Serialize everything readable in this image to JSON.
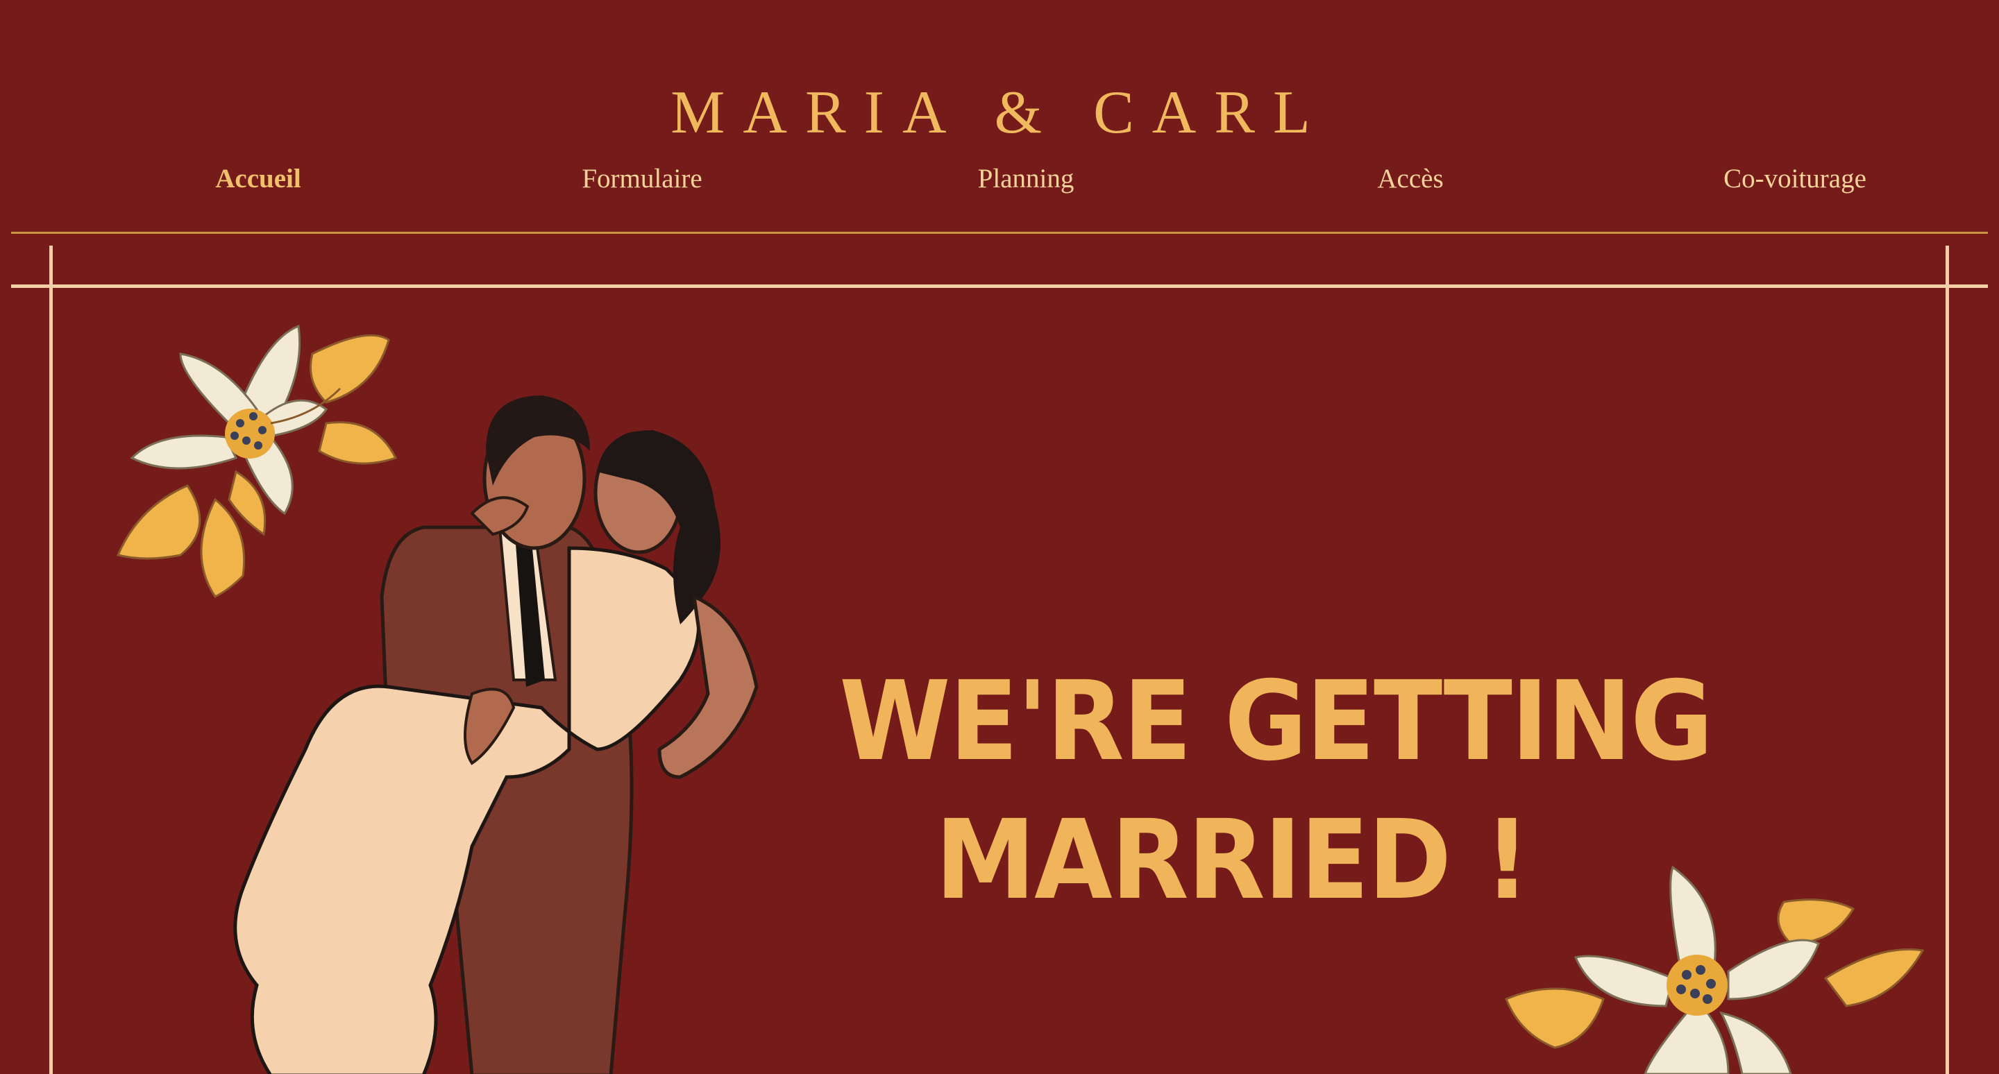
{
  "header": {
    "title": "MARIA & CARL"
  },
  "nav": {
    "items": [
      {
        "label": "Accueil",
        "active": true
      },
      {
        "label": "Formulaire",
        "active": false
      },
      {
        "label": "Planning",
        "active": false
      },
      {
        "label": "Accès",
        "active": false
      },
      {
        "label": "Co-voiturage",
        "active": false
      }
    ]
  },
  "hero": {
    "line1": "WE'RE GETTING",
    "line2": "MARRIED !"
  },
  "colors": {
    "background": "#751c1b",
    "accent_gold": "#f0b55a",
    "frame_cream": "#f3cfa7"
  },
  "icons": {
    "flower_top_left": "lily-flower-illustration",
    "flower_bottom_right": "lily-flower-illustration",
    "couple": "wedding-couple-illustration"
  }
}
